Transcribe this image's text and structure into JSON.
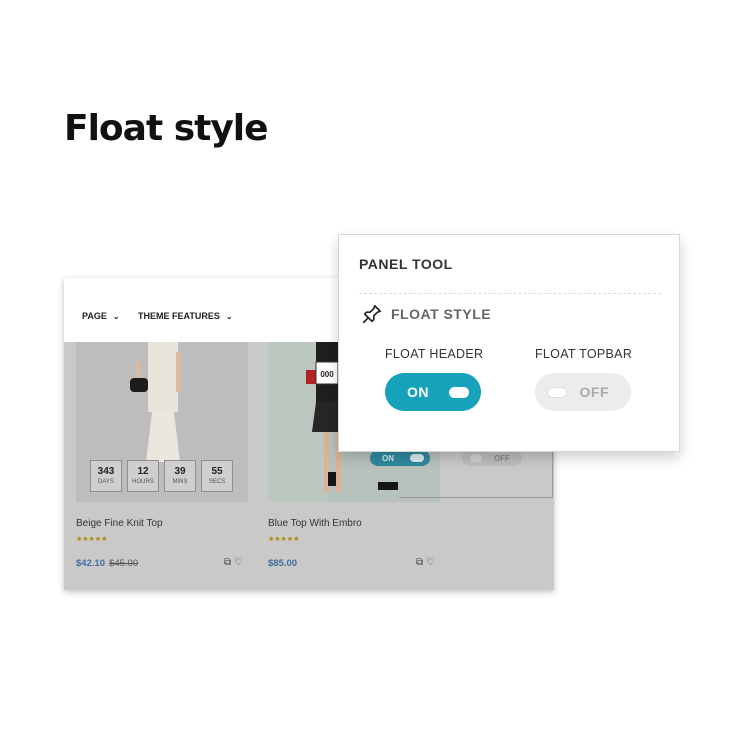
{
  "heading": "Float style",
  "shop": {
    "nav": [
      {
        "label": "PAGE"
      },
      {
        "label": "THEME FEATURES"
      }
    ],
    "countdown": [
      {
        "value": "343",
        "unit": "DAYS"
      },
      {
        "value": "12",
        "unit": "HOURS"
      },
      {
        "value": "39",
        "unit": "MINS"
      },
      {
        "value": "55",
        "unit": "SECS"
      }
    ],
    "hang_tag": "000",
    "products": [
      {
        "name": "Beige Fine Knit Top",
        "rating": "★★★★★",
        "price": "$42.10",
        "old_price": "$45.00"
      },
      {
        "name": "Blue Top With Embro",
        "rating": "★★★★★",
        "price": "$85.00",
        "old_price": ""
      }
    ],
    "ghost_on": "ON",
    "ghost_off": "OFF"
  },
  "panel": {
    "title": "PANEL TOOL",
    "section_icon": "pin-icon",
    "section_label": "FLOAT STYLE",
    "options": [
      {
        "label": "FLOAT HEADER",
        "state": "ON",
        "enabled": true
      },
      {
        "label": "FLOAT TOPBAR",
        "state": "OFF",
        "enabled": false
      }
    ],
    "accent_color": "#16a2b8"
  }
}
